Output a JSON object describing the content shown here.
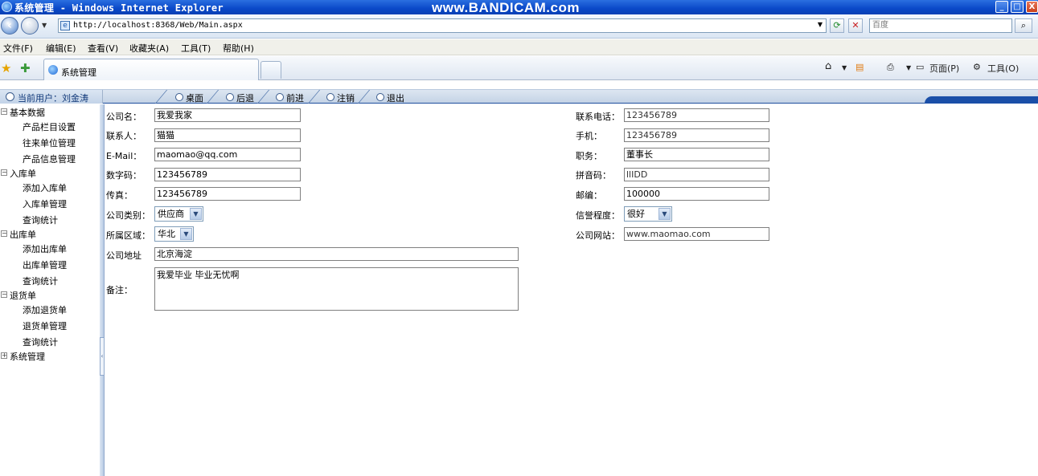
{
  "window": {
    "title": "系统管理 - Windows Internet Explorer",
    "watermark": "www.BANDICAM.com",
    "controls": [
      "_",
      "□",
      "X"
    ]
  },
  "addressbar": {
    "url": "http://localhost:8368/Web/Main.aspx",
    "search_placeholder": "百度"
  },
  "menu": {
    "items": [
      "文件(F)",
      "编辑(E)",
      "查看(V)",
      "收藏夹(A)",
      "工具(T)",
      "帮助(H)"
    ]
  },
  "tabs": {
    "active_label": "系统管理",
    "tools": {
      "page": "页面(P)",
      "tools": "工具(O)"
    }
  },
  "header": {
    "current_user": "当前用户：刘金涛",
    "nav": [
      "桌面",
      "后退",
      "前进",
      "注销",
      "退出"
    ]
  },
  "sidebar": {
    "groups": [
      {
        "label": "基本数据",
        "expander": "−",
        "items": [
          "产品栏目设置",
          "往来单位管理",
          "产品信息管理"
        ]
      },
      {
        "label": "入库单",
        "expander": "−",
        "items": [
          "添加入库单",
          "入库单管理",
          "查询统计"
        ]
      },
      {
        "label": "出库单",
        "expander": "−",
        "items": [
          "添加出库单",
          "出库单管理",
          "查询统计"
        ]
      },
      {
        "label": "退货单",
        "expander": "−",
        "items": [
          "添加退货单",
          "退货单管理",
          "查询统计"
        ]
      },
      {
        "label": "系统管理",
        "expander": "+",
        "items": []
      }
    ]
  },
  "form": {
    "company_name": {
      "label": "公司名：",
      "value": "我爱我家"
    },
    "contact": {
      "label": "联系人：",
      "value": "猫猫"
    },
    "email": {
      "label": "E-Mail：",
      "value": "maomao@qq.com"
    },
    "digit_code": {
      "label": "数字码：",
      "value": "123456789"
    },
    "fax": {
      "label": "传真：",
      "value": "123456789"
    },
    "company_type": {
      "label": "公司类别：",
      "value": "供应商"
    },
    "region": {
      "label": "所属区域：",
      "value": "华北"
    },
    "address": {
      "label": "公司地址",
      "value": "北京海淀"
    },
    "remark": {
      "label": "备注：",
      "value": "我爱毕业 毕业无忧啊"
    },
    "phone": {
      "label": "联系电话：",
      "value": "123456789"
    },
    "mobile": {
      "label": "手机：",
      "value": "123456789"
    },
    "position": {
      "label": "职务：",
      "value": "董事长"
    },
    "pinyin_code": {
      "label": "拼音码：",
      "value": "llIDD"
    },
    "postcode": {
      "label": "邮编：",
      "value": "100000"
    },
    "credit": {
      "label": "信誉程度：",
      "value": "很好"
    },
    "website": {
      "label": "公司网站：",
      "value": "www.maomao.com"
    }
  }
}
